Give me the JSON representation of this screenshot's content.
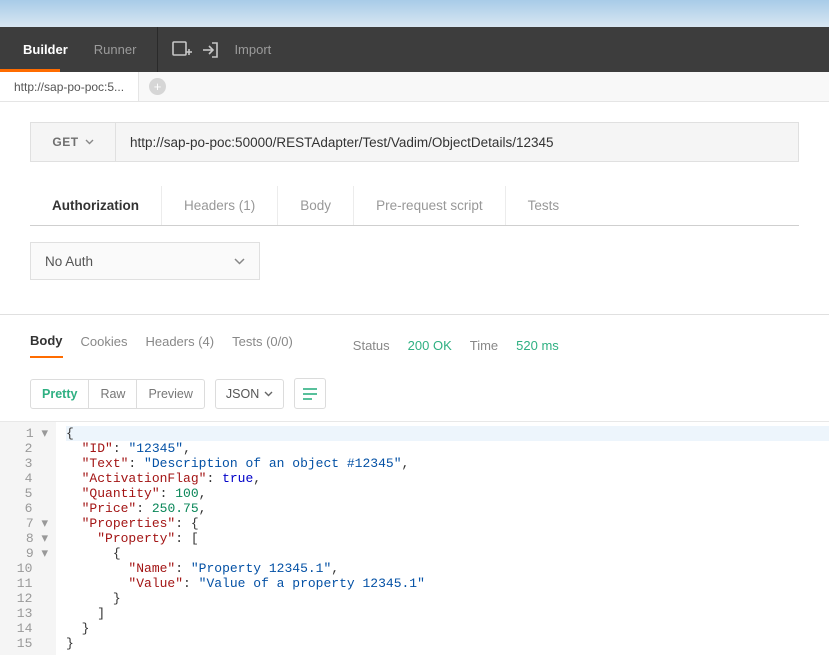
{
  "topbar": {
    "tabs": [
      "Builder",
      "Runner"
    ],
    "active_index": 0,
    "import_label": "Import"
  },
  "request_tabs": {
    "items": [
      "http://sap-po-poc:5..."
    ],
    "active_index": 0
  },
  "request": {
    "method": "GET",
    "url": "http://sap-po-poc:50000/RESTAdapter/Test/Vadim/ObjectDetails/12345"
  },
  "request_subtabs": {
    "items": [
      "Authorization",
      "Headers (1)",
      "Body",
      "Pre-request script",
      "Tests"
    ],
    "active_index": 0
  },
  "auth": {
    "type": "No Auth"
  },
  "response_tabs": {
    "items": [
      "Body",
      "Cookies",
      "Headers (4)",
      "Tests (0/0)"
    ],
    "active_index": 0
  },
  "status": {
    "label": "Status",
    "value": "200 OK"
  },
  "time": {
    "label": "Time",
    "value": "520 ms"
  },
  "format": {
    "modes": [
      "Pretty",
      "Raw",
      "Preview"
    ],
    "active_mode": 0,
    "language": "JSON"
  },
  "response_body": {
    "ID": "12345",
    "Text": "Description of an object #12345",
    "ActivationFlag": true,
    "Quantity": 100,
    "Price": 250.75,
    "Properties": {
      "Property": [
        {
          "Name": "Property 12345.1",
          "Value": "Value of a property 12345.1"
        }
      ]
    }
  },
  "code_lines": [
    "{",
    "  \"ID\": \"12345\",",
    "  \"Text\": \"Description of an object #12345\",",
    "  \"ActivationFlag\": true,",
    "  \"Quantity\": 100,",
    "  \"Price\": 250.75,",
    "  \"Properties\": {",
    "    \"Property\": [",
    "      {",
    "        \"Name\": \"Property 12345.1\",",
    "        \"Value\": \"Value of a property 12345.1\"",
    "      }",
    "    ]",
    "  }",
    "}"
  ],
  "gutter_markers": {
    "1": "▾",
    "7": "▾",
    "8": "▾",
    "9": "▾"
  }
}
